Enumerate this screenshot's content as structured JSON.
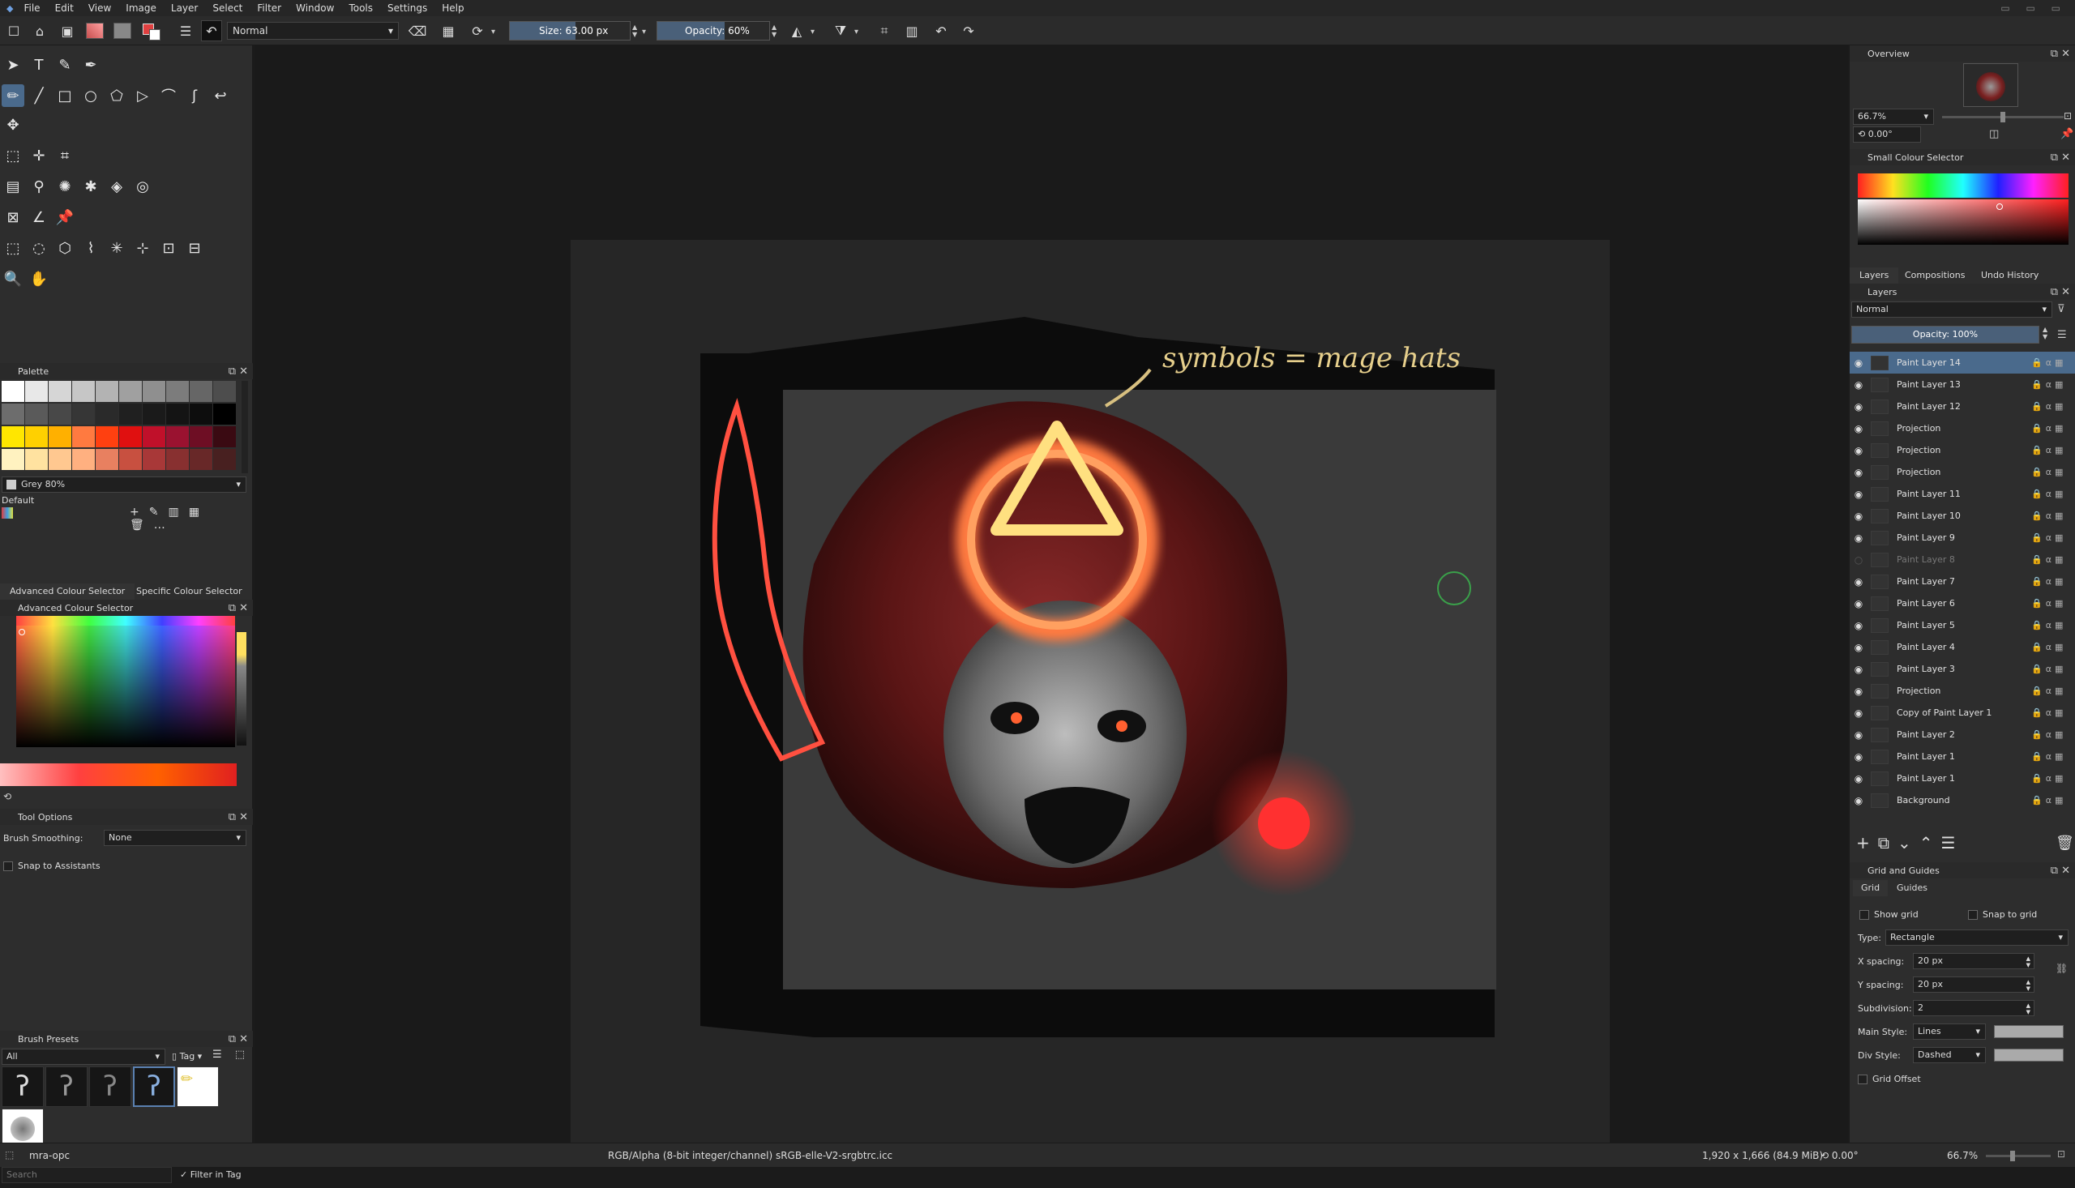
{
  "menus": [
    "File",
    "Edit",
    "View",
    "Image",
    "Layer",
    "Select",
    "Filter",
    "Window",
    "Tools",
    "Settings",
    "Help"
  ],
  "toolbar": {
    "blend_mode": "Normal",
    "size_label": "Size: 63.00 px",
    "opacity_label": "Opacity: 60%",
    "size_fraction": 0.55,
    "opacity_fraction": 0.6
  },
  "palette": {
    "title": "Palette",
    "selected_color_name": "Grey 80%",
    "preset_name": "Default",
    "rows": [
      [
        "#ffffff",
        "#e8e8e8",
        "#d6d6d6",
        "#c6c6c6",
        "#b3b3b3",
        "#a0a0a0",
        "#8f8f8f",
        "#7c7c7c",
        "#666666",
        "#4d4d4d"
      ],
      [
        "#6d6d6d",
        "#5a5a5a",
        "#484848",
        "#363636",
        "#2a2a2a",
        "#202020",
        "#1a1a1a",
        "#141414",
        "#0d0d0d",
        "#000000"
      ],
      [
        "#ffe600",
        "#ffd000",
        "#ffb000",
        "#ff7a40",
        "#ff4010",
        "#e01010",
        "#c0102a",
        "#9a1230",
        "#6e0e24",
        "#3a0a12"
      ],
      [
        "#fff2c0",
        "#ffe2a0",
        "#ffc890",
        "#ffb080",
        "#e88060",
        "#c85040",
        "#a83838",
        "#883030",
        "#682828",
        "#482020"
      ]
    ]
  },
  "colour_tabs": [
    "Advanced Colour Selector",
    "Specific Colour Selector"
  ],
  "advanced_colour_title": "Advanced Colour Selector",
  "tool_options": {
    "title": "Tool Options",
    "smoothing_label": "Brush Smoothing:",
    "smoothing_value": "None",
    "snap_label": "Snap to Assistants"
  },
  "brush_presets": {
    "title": "Brush Presets",
    "filter_value": "All",
    "tag_label": "Tag",
    "search_placeholder": "Search",
    "filter_in_tag_label": "Filter in Tag"
  },
  "canvas": {
    "annotation": "symbols = mage hats"
  },
  "overview": {
    "title": "Overview",
    "zoom": "66.7%",
    "rotation": "0.00°"
  },
  "small_colour_title": "Small Colour Selector",
  "layer_tabs": [
    "Layers",
    "Compositions",
    "Undo History"
  ],
  "layers_panel": {
    "title": "Layers",
    "blend_mode": "Normal",
    "opacity_label": "Opacity: 100%",
    "items": [
      {
        "name": "Paint Layer 14",
        "selected": true,
        "visible": true
      },
      {
        "name": "Paint Layer 13",
        "selected": false,
        "visible": true
      },
      {
        "name": "Paint Layer 12",
        "selected": false,
        "visible": true
      },
      {
        "name": "Projection",
        "selected": false,
        "visible": true
      },
      {
        "name": "Projection",
        "selected": false,
        "visible": true
      },
      {
        "name": "Projection",
        "selected": false,
        "visible": true
      },
      {
        "name": "Paint Layer 11",
        "selected": false,
        "visible": true
      },
      {
        "name": "Paint Layer 10",
        "selected": false,
        "visible": true
      },
      {
        "name": "Paint Layer 9",
        "selected": false,
        "visible": true
      },
      {
        "name": "Paint Layer 8",
        "selected": false,
        "visible": false
      },
      {
        "name": "Paint Layer 7",
        "selected": false,
        "visible": true
      },
      {
        "name": "Paint Layer 6",
        "selected": false,
        "visible": true
      },
      {
        "name": "Paint Layer 5",
        "selected": false,
        "visible": true
      },
      {
        "name": "Paint Layer 4",
        "selected": false,
        "visible": true
      },
      {
        "name": "Paint Layer 3",
        "selected": false,
        "visible": true
      },
      {
        "name": "Projection",
        "selected": false,
        "visible": true
      },
      {
        "name": "Copy of Paint Layer 1",
        "selected": false,
        "visible": true
      },
      {
        "name": "Paint Layer 2",
        "selected": false,
        "visible": true
      },
      {
        "name": "Paint Layer 1",
        "selected": false,
        "visible": true
      },
      {
        "name": "Paint Layer 1",
        "selected": false,
        "visible": true
      },
      {
        "name": "Background",
        "selected": false,
        "visible": true
      }
    ]
  },
  "grid_guides": {
    "title": "Grid and Guides",
    "tabs": [
      "Grid",
      "Guides"
    ],
    "show_grid_label": "Show grid",
    "snap_grid_label": "Snap to grid",
    "type_label": "Type:",
    "type_value": "Rectangle",
    "xspacing_label": "X spacing:",
    "xspacing_value": "20 px",
    "yspacing_label": "Y spacing:",
    "yspacing_value": "20 px",
    "subdivision_label": "Subdivision:",
    "subdivision_value": "2",
    "main_style_label": "Main Style:",
    "main_style_value": "Lines",
    "div_style_label": "Div Style:",
    "div_style_value": "Dashed",
    "grid_offset_label": "Grid Offset"
  },
  "status": {
    "filename": "mra-opc",
    "colorspace": "RGB/Alpha (8-bit integer/channel)  sRGB-elle-V2-srgbtrc.icc",
    "dimensions": "1,920 x 1,666 (84.9 MiB)",
    "rotation": "0.00°",
    "zoom": "66.7%"
  }
}
